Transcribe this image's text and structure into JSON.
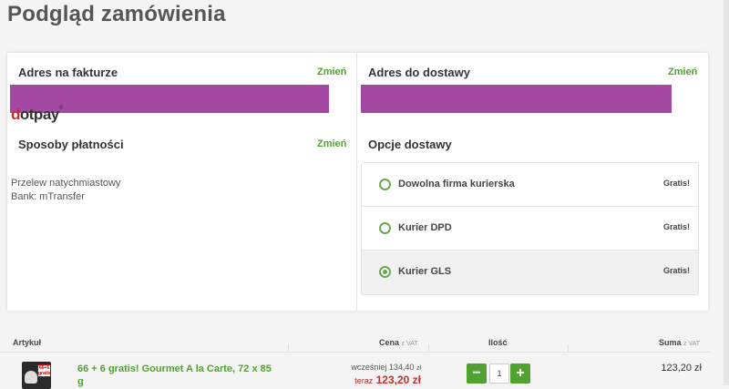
{
  "page_title": "Podgląd zamówienia",
  "billing": {
    "title": "Adres na fakturze",
    "change": "Zmień"
  },
  "shipping_address": {
    "title": "Adres do dostawy",
    "change": "Zmień"
  },
  "payment": {
    "title": "Sposoby płatności",
    "change": "Zmień",
    "logo_text": "dotpay",
    "method": "Przelew natychmiastowy",
    "bank": "Bank:  mTransfer"
  },
  "delivery": {
    "title": "Opcje dostawy",
    "options": [
      {
        "name": "Dowolna firma kurierska",
        "price": "Gratis!",
        "selected": false
      },
      {
        "name": "Kurier DPD",
        "price": "Gratis!",
        "selected": false
      },
      {
        "name": "Kurier GLS",
        "price": "Gratis!",
        "selected": true
      }
    ]
  },
  "table": {
    "headers": {
      "article": "Artykuł",
      "price": "Cena",
      "price_note": "z VAT",
      "qty": "Ilość",
      "sum": "Suma",
      "sum_note": "z VAT"
    },
    "rows": [
      {
        "name": "66 + 6 gratis! Gourmet A la Carte, 72 x 85 g",
        "badge": "66+6 gratis",
        "old_price_label": "wcześniej",
        "old_price": "134,40",
        "old_price_unit": "zł",
        "now_label": "teraz",
        "now_price": "123,20 zł",
        "qty": "1",
        "sum": "123,20 zł"
      }
    ]
  },
  "colors": {
    "accent": "#52a232",
    "redacted": "#a349a4",
    "price_red": "#c9302c"
  }
}
